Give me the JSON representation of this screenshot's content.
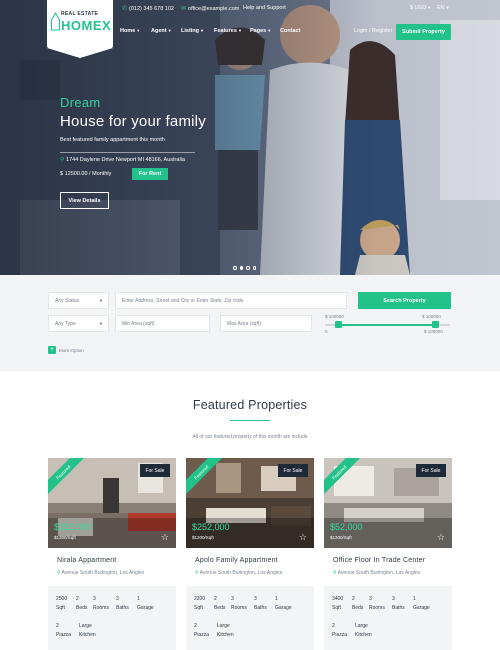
{
  "brand": {
    "small": "REAL ESTATE",
    "big": "HOMEX"
  },
  "topbar": {
    "phone": "(012) 345 678 102",
    "email": "office@example.com",
    "help": "Help and Support",
    "currency": "$ USD",
    "language": "EN"
  },
  "nav": {
    "items": [
      "Home",
      "Agent",
      "Listing",
      "Features",
      "Pages",
      "Contact"
    ],
    "login": "Login / Register",
    "submit": "Submit Property"
  },
  "hero": {
    "kicker": "Dream",
    "title": "House for your family",
    "subtitle": "Best featured family appartment this month",
    "address": "1744 Daylene Drive Newport MI 48166, Australia",
    "price": "$ 12500.00 / Monthly",
    "tag": "For Rent",
    "details": "View Details"
  },
  "search": {
    "status": "Any Status",
    "address_placeholder": "Enter Address, Street and City or Enter State, Zip code",
    "button": "Search Property",
    "type": "Any Type",
    "min_area": "Min Area (sqft)",
    "max_area": "Max Area (sqft)",
    "range_low": "$ 100000",
    "range_high": "$ 100000",
    "range_min": "0",
    "range_max": "$ 100000",
    "more": "More Option"
  },
  "featured": {
    "title": "Featured Properties",
    "subtitle": "All of our featured property of this month are include",
    "cards": [
      {
        "ribbon": "Featured",
        "status": "For Sale",
        "price": "$352,000",
        "sqft": "$1300/Sqft",
        "name": "Nirala Appartment",
        "address": "Avenue South Burlington, Los Angles",
        "stats": [
          {
            "v": "2500",
            "l": "Sqft"
          },
          {
            "v": "2",
            "l": "Beds"
          },
          {
            "v": "3",
            "l": "Rooms"
          },
          {
            "v": "3",
            "l": "Baths"
          },
          {
            "v": "1",
            "l": "Garage"
          },
          {
            "v": "2",
            "l": "Piazza"
          },
          {
            "v": "Large",
            "l": "Kitchen"
          }
        ]
      },
      {
        "ribbon": "Featured",
        "status": "For Sale",
        "price": "$252,000",
        "sqft": "$1200/Sqft",
        "name": "Apolo Family Appartment",
        "address": "Avenue South Burlington, Los Angles",
        "stats": [
          {
            "v": "2200",
            "l": "Sqft"
          },
          {
            "v": "2",
            "l": "Beds"
          },
          {
            "v": "3",
            "l": "Rooms"
          },
          {
            "v": "3",
            "l": "Baths"
          },
          {
            "v": "1",
            "l": "Garage"
          },
          {
            "v": "2",
            "l": "Piazza"
          },
          {
            "v": "Large",
            "l": "Kitchen"
          }
        ]
      },
      {
        "ribbon": "Featured",
        "status": "For Sale",
        "price": "$52,000",
        "sqft": "$1200/Sqft",
        "name": "Office Floor In Trade Center",
        "address": "Avenue South Burlington, Los Angles",
        "stats": [
          {
            "v": "3400",
            "l": "Sqft"
          },
          {
            "v": "2",
            "l": "Beds"
          },
          {
            "v": "3",
            "l": "Rooms"
          },
          {
            "v": "3",
            "l": "Baths"
          },
          {
            "v": "1",
            "l": "Garage"
          },
          {
            "v": "2",
            "l": "Piazza"
          },
          {
            "v": "Large",
            "l": "Kitchen"
          }
        ]
      }
    ]
  },
  "colors": {
    "accent": "#22c28a",
    "dark": "#1f2a38",
    "panel": "#f3f4f6"
  }
}
